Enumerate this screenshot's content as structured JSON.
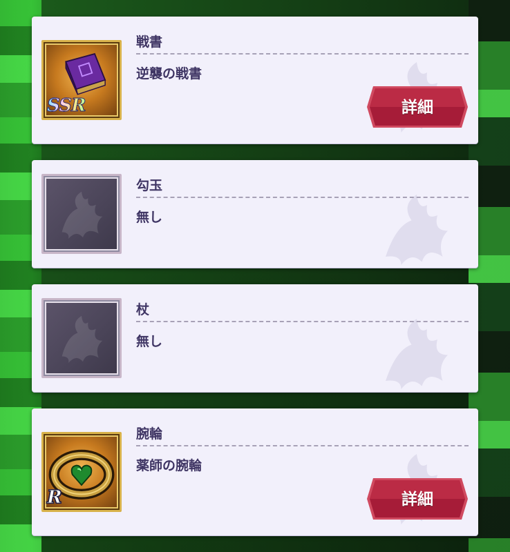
{
  "equipment": [
    {
      "slot": "戦書",
      "name": "逆襲の戦書",
      "rarity": "SSR",
      "icon": "purple-book-icon",
      "detail_label": "詳細"
    },
    {
      "slot": "勾玉",
      "name": "無し",
      "rarity": "",
      "icon": "empty-slot-griffin-icon",
      "detail_label": ""
    },
    {
      "slot": "杖",
      "name": "無し",
      "rarity": "",
      "icon": "empty-slot-griffin-icon",
      "detail_label": ""
    },
    {
      "slot": "腕輪",
      "name": "薬師の腕輪",
      "rarity": "R",
      "icon": "emerald-heart-bracelet-icon",
      "detail_label": "詳細"
    }
  ],
  "colors": {
    "card_bg": "#f2f0fb",
    "text": "#3f3564",
    "button_red": "#b3243e",
    "icon_gold_frame": "#d8b24a",
    "background_green": "#2fae2f"
  }
}
